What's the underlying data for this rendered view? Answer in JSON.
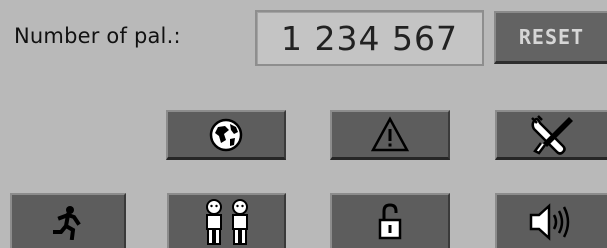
{
  "counter": {
    "label": "Number of pal.:",
    "value": "1 234 567",
    "reset_label": "RESET"
  },
  "tiles": [
    {
      "id": "globe",
      "icon": "globe-icon"
    },
    {
      "id": "warning",
      "icon": "warning-triangle-icon"
    },
    {
      "id": "tools",
      "icon": "wrench-screwdriver-icon"
    },
    {
      "id": "exit",
      "icon": "running-person-icon"
    },
    {
      "id": "users",
      "icon": "two-persons-icon"
    },
    {
      "id": "lock",
      "icon": "unlocked-padlock-icon"
    },
    {
      "id": "sound",
      "icon": "speaker-icon"
    }
  ]
}
